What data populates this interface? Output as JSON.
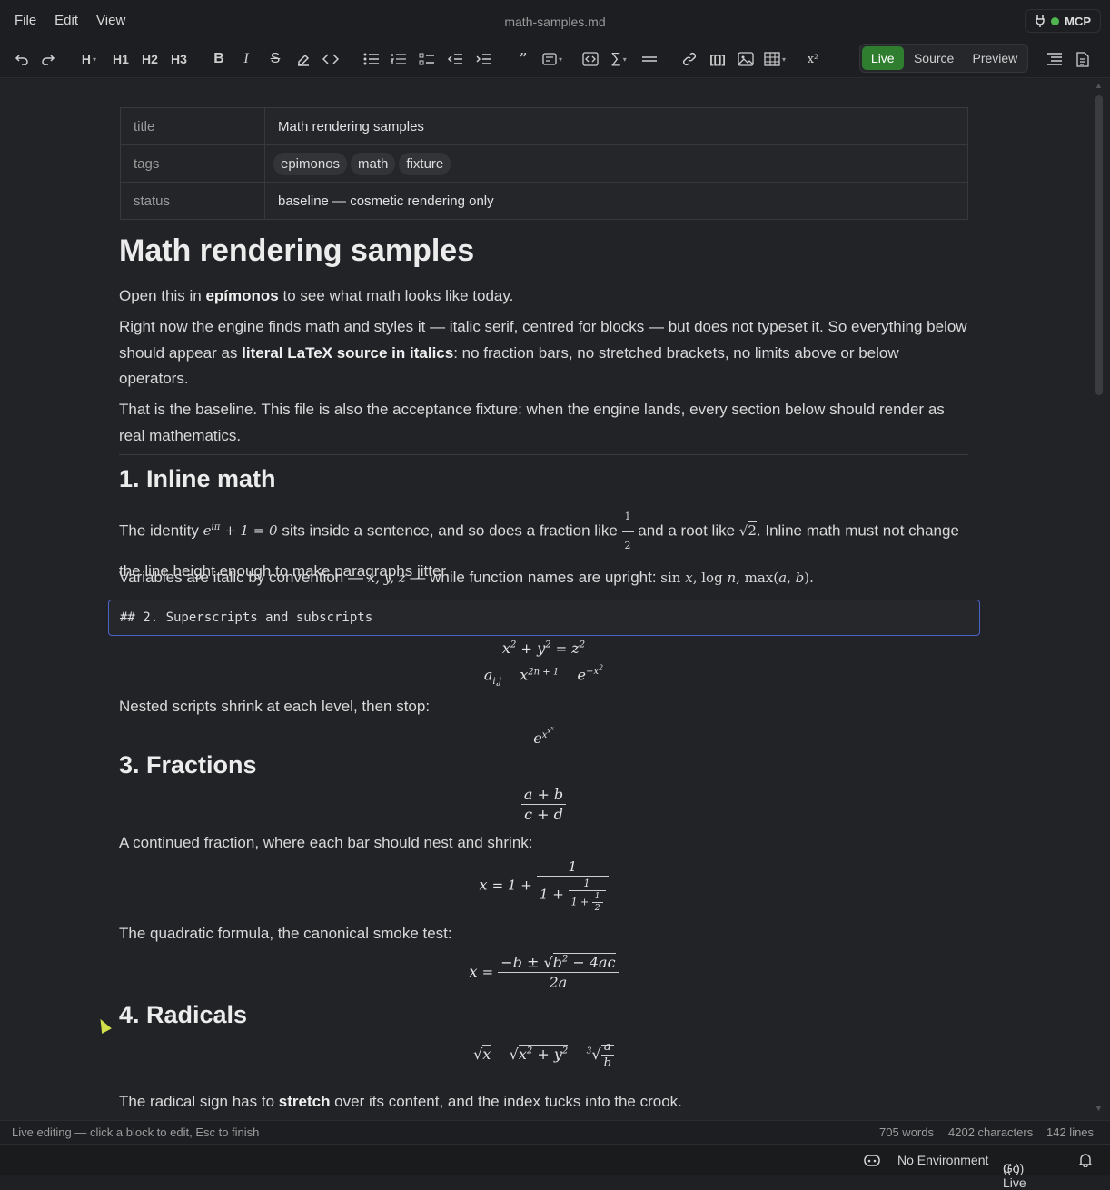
{
  "menu": [
    "File",
    "Edit",
    "View"
  ],
  "window_title": "math-samples.md",
  "mcp_label": "MCP",
  "toolbar": {
    "heading_label": "H",
    "h1": "H1",
    "h2": "H2",
    "h3": "H3",
    "superscript": "x²",
    "icons": [
      "undo-icon",
      "redo-icon",
      "bold-icon",
      "italic-icon",
      "strikethrough-icon",
      "highlight-icon",
      "code-icon",
      "bullet-list-icon",
      "numbered-list-icon",
      "task-list-icon",
      "outdent-icon",
      "indent-icon",
      "quote-icon",
      "callout-icon",
      "code-block-icon",
      "math-icon",
      "horizontal-rule-icon",
      "link-icon",
      "wikilink-icon",
      "image-icon",
      "table-icon",
      "outline-icon",
      "document-icon"
    ]
  },
  "modes": {
    "live": "Live",
    "source": "Source",
    "preview": "Preview",
    "active": "Live"
  },
  "frontmatter": {
    "title_key": "title",
    "title_value": "Math rendering samples",
    "tags_key": "tags",
    "tags": [
      "epimonos",
      "math",
      "fixture"
    ],
    "status_key": "status",
    "status_value": "baseline — cosmetic rendering only"
  },
  "doc": {
    "h1": "Math rendering samples",
    "intro1_pre": "Open this in ",
    "intro1_bold": "epímonos",
    "intro1_post": " to see what math looks like today.",
    "intro2_pre": "Right now the engine finds math and styles it — italic serif, centred for blocks — but does not typeset it. So everything below should appear as ",
    "intro2_bold": "literal LaTeX source in italics",
    "intro2_post": ": no fraction bars, no stretched brackets, no limits above or below operators.",
    "intro3": "That is the baseline. This file is also the acceptance fixture: when the engine lands, every section below should render as real mathematics.",
    "s1_heading": "1. Inline math",
    "s1_p1_a": "The identity ",
    "s1_p1_b": " sits inside a sentence, and so does a fraction like ",
    "s1_p1_c": " and a root like ",
    "s1_p1_d": ". Inline math must not change the line height enough to make paragraphs jitter.",
    "s1_p2_a": "Variables are italic by convention — ",
    "s1_p2_b": " — while function names are upright: ",
    "s2_source": "## 2. Superscripts and subscripts",
    "s2_p1": "Nested scripts shrink at each level, then stop:",
    "s3_heading": "3. Fractions",
    "s3_p1": "A continued fraction, where each bar should nest and shrink:",
    "s3_p2": "The quadratic formula, the canonical smoke test:",
    "s4_heading": "4. Radicals",
    "s4_p1_pre": "The radical sign has to ",
    "s4_p1_bold": "stretch",
    "s4_p1_post": " over its content, and the index tucks into the crook."
  },
  "status": {
    "hint": "Live editing — click a block to edit, Esc to finish",
    "words": "705 words",
    "characters": "4202 characters",
    "lines": "142 lines"
  },
  "bottom": {
    "environment": "No Environment",
    "go_live": "Go Live"
  }
}
